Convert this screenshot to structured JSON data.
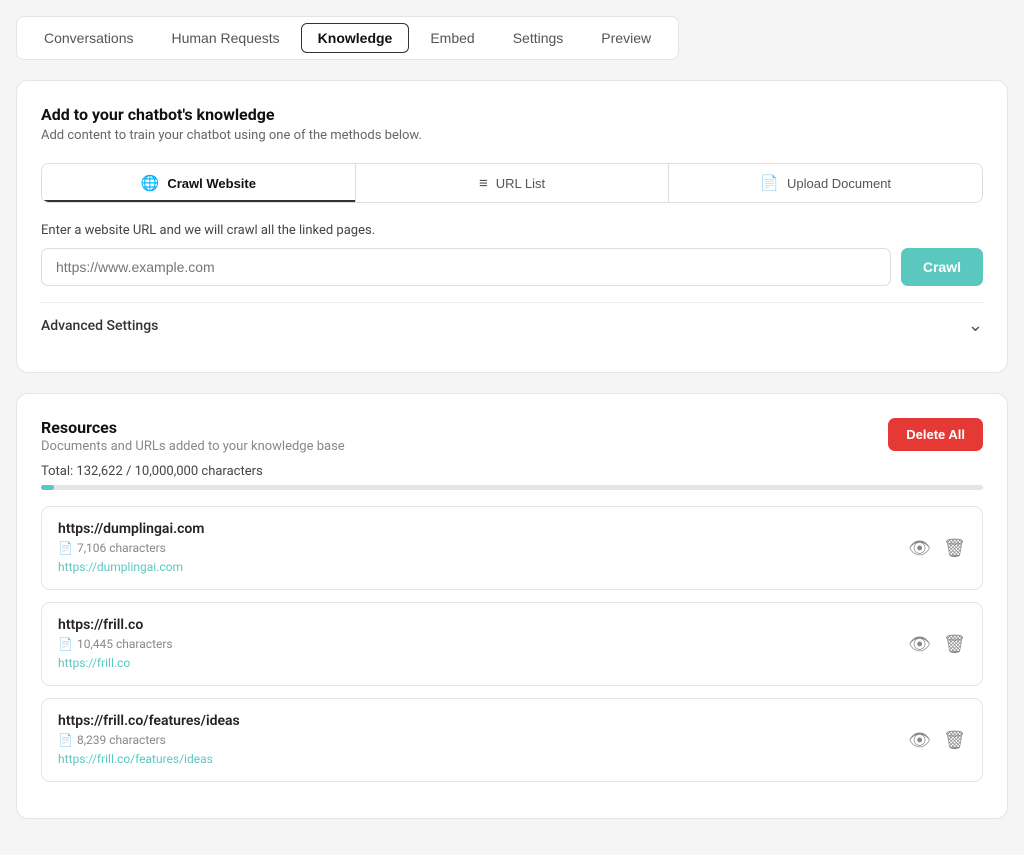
{
  "nav": {
    "tabs": [
      {
        "id": "conversations",
        "label": "Conversations",
        "active": false
      },
      {
        "id": "human-requests",
        "label": "Human Requests",
        "active": false
      },
      {
        "id": "knowledge",
        "label": "Knowledge",
        "active": true
      },
      {
        "id": "embed",
        "label": "Embed",
        "active": false
      },
      {
        "id": "settings",
        "label": "Settings",
        "active": false
      },
      {
        "id": "preview",
        "label": "Preview",
        "active": false
      }
    ]
  },
  "add_knowledge": {
    "title": "Add to your chatbot's knowledge",
    "subtitle": "Add content to train your chatbot using one of the methods below.",
    "method_tabs": [
      {
        "id": "crawl-website",
        "label": "Crawl Website",
        "icon": "🌐",
        "active": true
      },
      {
        "id": "url-list",
        "label": "URL List",
        "icon": "≡",
        "active": false
      },
      {
        "id": "upload-document",
        "label": "Upload Document",
        "icon": "📄",
        "active": false
      }
    ],
    "url_description": "Enter a website URL and we will crawl all the linked pages.",
    "url_placeholder": "https://www.example.com",
    "crawl_button_label": "Crawl",
    "advanced_settings_label": "Advanced Settings"
  },
  "resources": {
    "title": "Resources",
    "subtitle": "Documents and URLs added to your knowledge base",
    "total_label": "Total: 132,622 / 10,000,000 characters",
    "progress_percent": 1.33,
    "delete_all_label": "Delete All",
    "items": [
      {
        "url": "https://dumplingai.com",
        "chars": "7,106 characters",
        "link": "https://dumplingai.com"
      },
      {
        "url": "https://frill.co",
        "chars": "10,445 characters",
        "link": "https://frill.co"
      },
      {
        "url": "https://frill.co/features/ideas",
        "chars": "8,239 characters",
        "link": "https://frill.co/features/ideas"
      }
    ]
  }
}
